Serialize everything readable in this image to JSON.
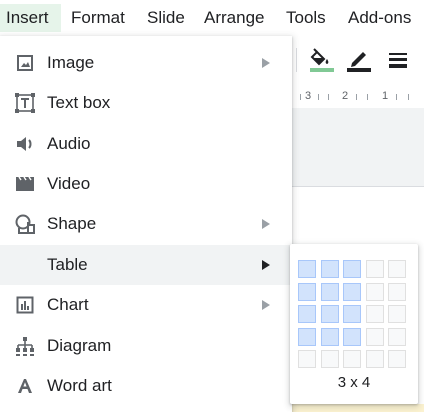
{
  "menubar": {
    "items": [
      {
        "label": "Insert",
        "active": true
      },
      {
        "label": "Format",
        "active": false
      },
      {
        "label": "Slide",
        "active": false
      },
      {
        "label": "Arrange",
        "active": false
      },
      {
        "label": "Tools",
        "active": false
      },
      {
        "label": "Add-ons",
        "active": false
      }
    ]
  },
  "ruler": {
    "marks": [
      "3",
      "2",
      "1"
    ]
  },
  "insert_menu": {
    "items": [
      {
        "label": "Image",
        "icon": "image-icon",
        "has_submenu": true
      },
      {
        "label": "Text box",
        "icon": "text-box-icon",
        "has_submenu": false
      },
      {
        "label": "Audio",
        "icon": "audio-icon",
        "has_submenu": false
      },
      {
        "label": "Video",
        "icon": "video-icon",
        "has_submenu": false
      },
      {
        "label": "Shape",
        "icon": "shape-icon",
        "has_submenu": true
      },
      {
        "label": "Table",
        "icon": "",
        "has_submenu": true,
        "highlighted": true
      },
      {
        "label": "Chart",
        "icon": "chart-icon",
        "has_submenu": true
      },
      {
        "label": "Diagram",
        "icon": "diagram-icon",
        "has_submenu": false
      },
      {
        "label": "Word art",
        "icon": "word-art-icon",
        "has_submenu": false
      }
    ]
  },
  "table_picker": {
    "selected_columns": 3,
    "selected_rows": 4,
    "grid_columns": 5,
    "grid_rows": 5,
    "size_label": "3 x 4"
  },
  "colors": {
    "active_menu_bg": "#e6f4ea",
    "highlight_bg": "#f1f3f4",
    "grid_selected": "#d2e3fc",
    "fill_color_bar": "#81c995",
    "pen_color_bar": "#202124"
  }
}
